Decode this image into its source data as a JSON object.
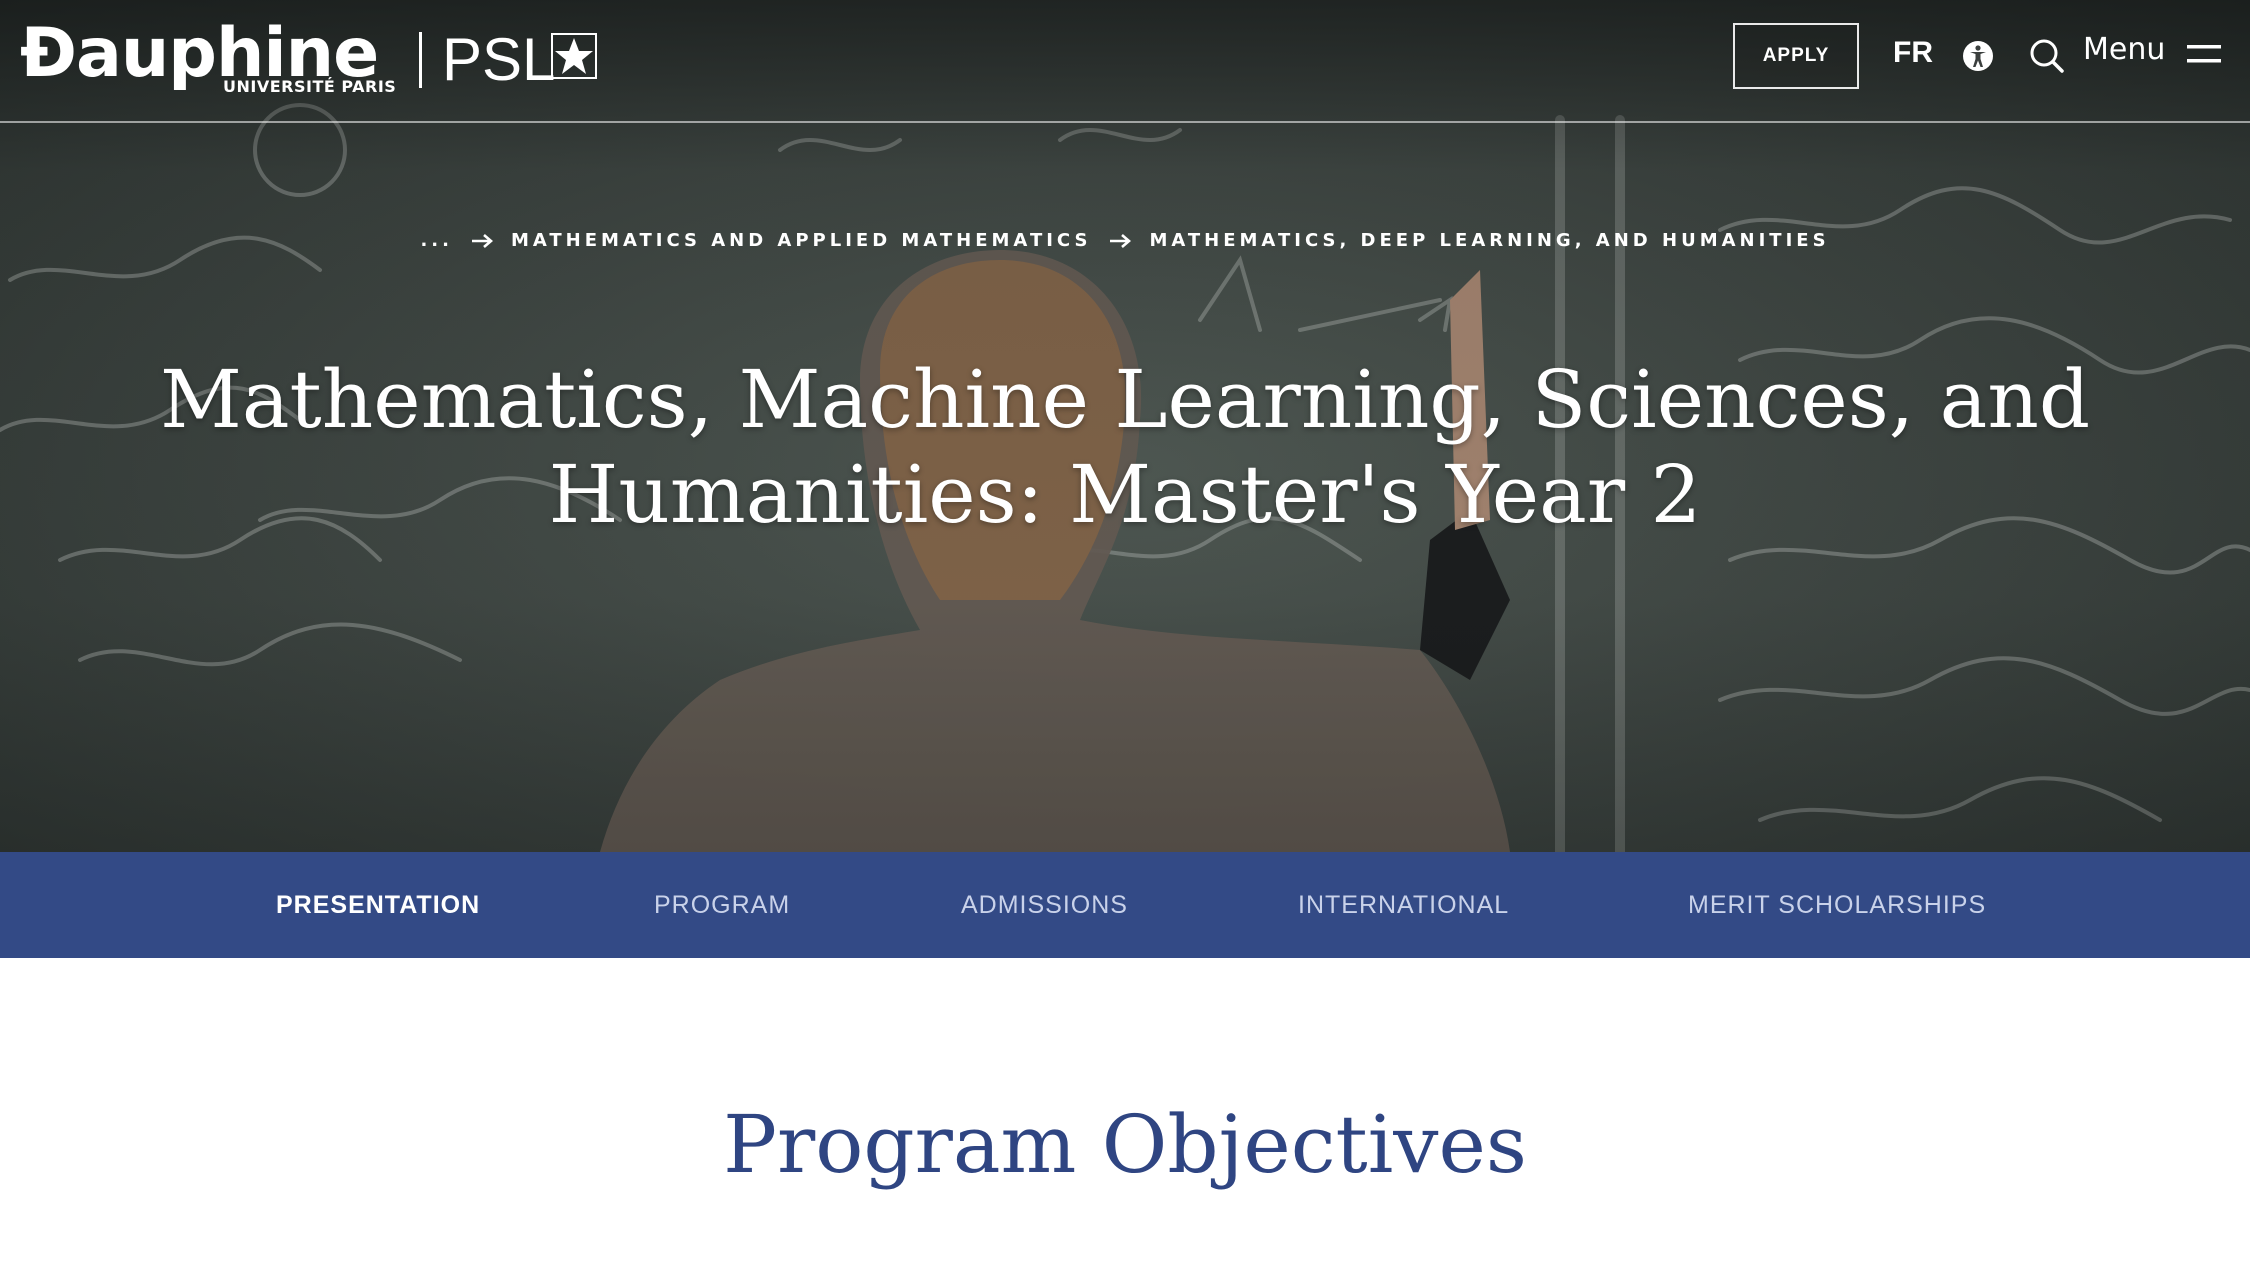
{
  "header": {
    "logo_word": "Đauphine",
    "logo_subtitle": "UNIVERSITÉ PARIS",
    "logo_partner": "PSL",
    "apply_label": "APPLY",
    "lang_label": "FR",
    "menu_label": "Menu",
    "icons": [
      "accessibility-icon",
      "search-icon",
      "hamburger-menu-icon",
      "psl-star-icon"
    ]
  },
  "breadcrumb": {
    "ellipsis": "...",
    "items": [
      "MATHEMATICS AND APPLIED MATHEMATICS",
      "MATHEMATICS, DEEP LEARNING, AND HUMANITIES"
    ]
  },
  "hero": {
    "title_line1": "Mathematics, Machine Learning, Sciences, and",
    "title_line2": "Humanities: Master's Year 2"
  },
  "tabs": [
    {
      "label": "PRESENTATION",
      "active": true
    },
    {
      "label": "PROGRAM",
      "active": false
    },
    {
      "label": "ADMISSIONS",
      "active": false
    },
    {
      "label": "INTERNATIONAL",
      "active": false
    },
    {
      "label": "MERIT SCHOLARSHIPS",
      "active": false
    }
  ],
  "main": {
    "section_title": "Program Objectives"
  },
  "colors": {
    "tab_bar": "#334a86",
    "tab_active": "#ffffff",
    "tab_inactive": "#c9d2ea",
    "section_title": "#2f4582"
  }
}
